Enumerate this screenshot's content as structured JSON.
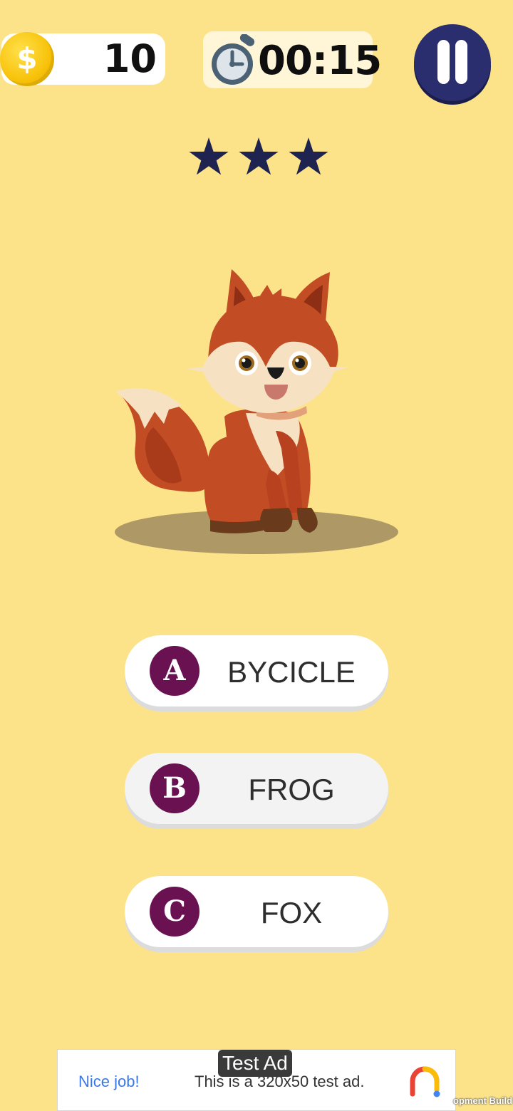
{
  "hud": {
    "coins": "10",
    "coin_symbol": "$",
    "timer": "00:15"
  },
  "stars": {
    "earned": 3,
    "total": 3,
    "color": "#1E2350"
  },
  "question": {
    "image": "fox-illustration"
  },
  "answers": [
    {
      "letter": "A",
      "text": "BYCICLE"
    },
    {
      "letter": "B",
      "text": "FROG"
    },
    {
      "letter": "C",
      "text": "FOX"
    }
  ],
  "ad": {
    "tag": "Test Ad",
    "headline": "Nice job!",
    "body": "This is a 320x50 test ad."
  },
  "footer": {
    "build_label": "opment Build"
  },
  "colors": {
    "background": "#FCE38A",
    "accent_purple": "#6A1152",
    "pause_button": "#2A2D6E",
    "coin": "#F8C20A"
  }
}
